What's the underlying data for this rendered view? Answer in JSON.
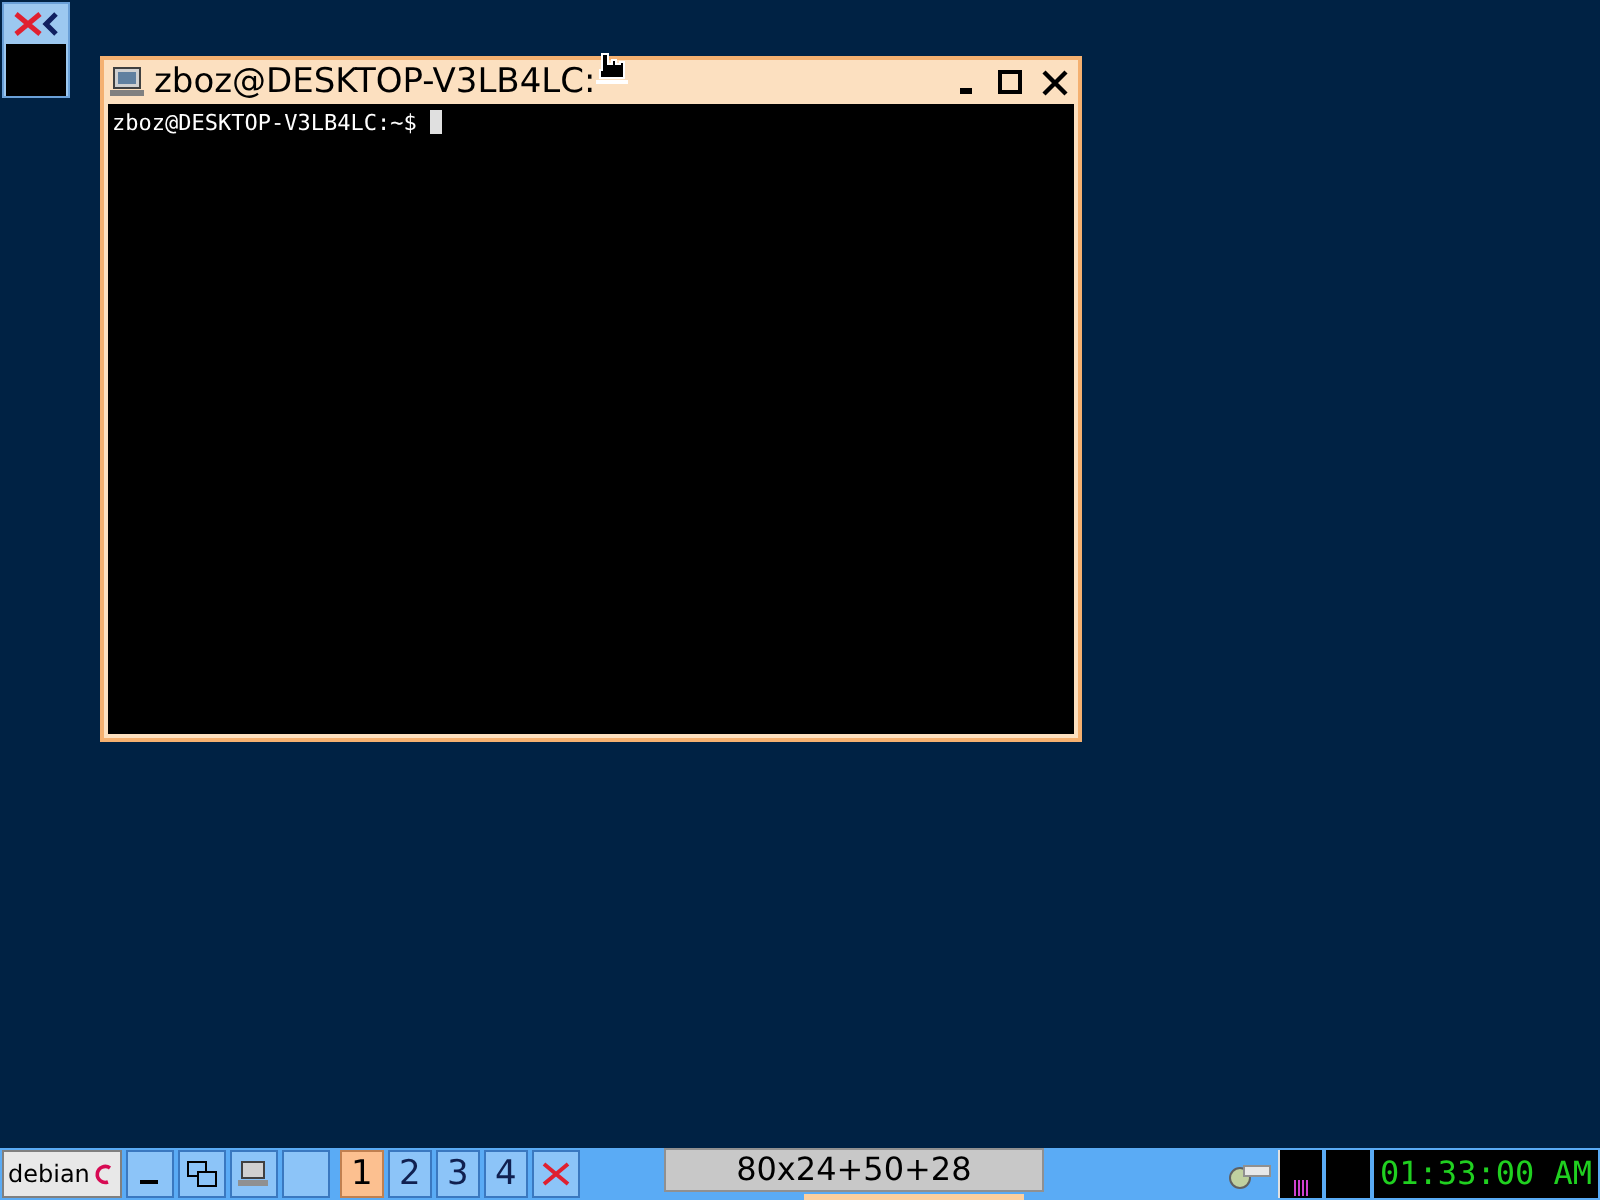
{
  "window": {
    "title": "zboz@DESKTOP-V3LB4LC:",
    "active": true
  },
  "terminal": {
    "lines": [
      "zboz@DESKTOP-V3LB4LC:~$ "
    ]
  },
  "taskbar": {
    "start_label": "debian",
    "desktops": [
      {
        "label": "1",
        "selected": true
      },
      {
        "label": "2",
        "selected": false
      },
      {
        "label": "3",
        "selected": false
      },
      {
        "label": "4",
        "selected": false
      }
    ],
    "geometry": "80x24+50+28",
    "clock": "01:33:00 AM"
  }
}
